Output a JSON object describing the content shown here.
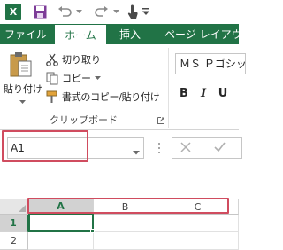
{
  "app": {
    "logo_letter": "X"
  },
  "ribbon_tabs": {
    "file": "ファイル",
    "home": "ホーム",
    "insert": "挿入",
    "page_layout": "ページ レイアウト"
  },
  "clipboard": {
    "paste": "貼り付け",
    "cut": "切り取り",
    "copy": "コピー",
    "format_painter": "書式のコピー/貼り付け",
    "group_label": "クリップボード"
  },
  "font": {
    "name": "ＭＳ Ｐゴシック",
    "bold": "B",
    "italic": "I",
    "underline": "U"
  },
  "formula_bar": {
    "name_box_value": "A1"
  },
  "grid": {
    "columns": [
      "A",
      "B",
      "C"
    ],
    "rows": [
      "1",
      "2"
    ],
    "selected_cell": "A1"
  },
  "colors": {
    "brand": "#217346",
    "highlight": "#d04c5f"
  }
}
